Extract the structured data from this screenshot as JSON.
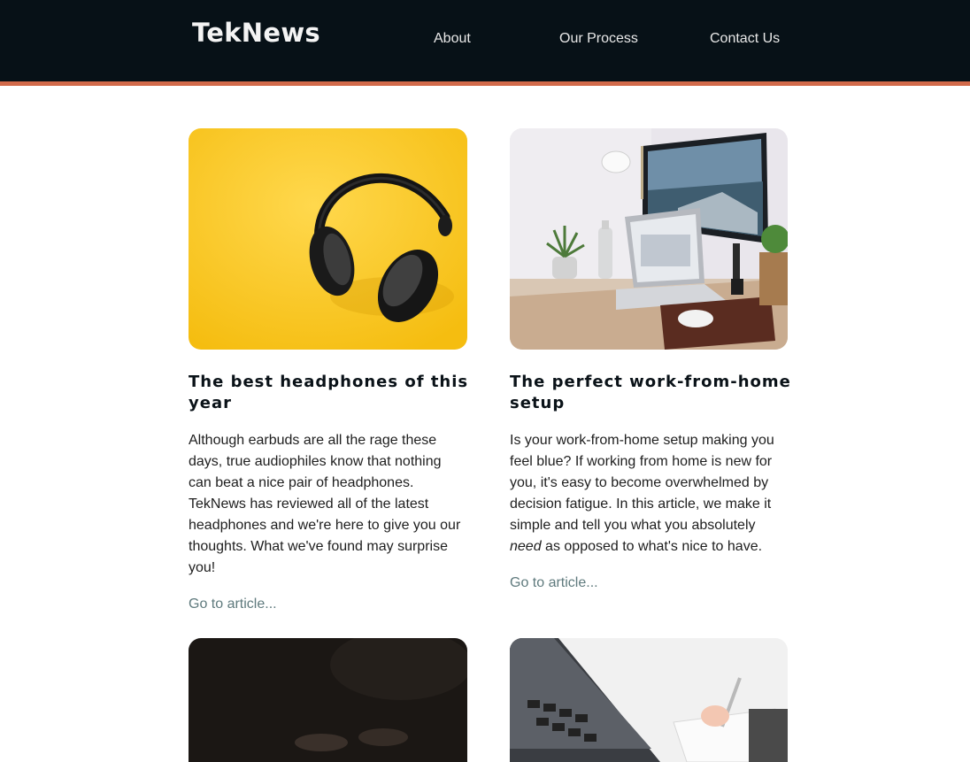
{
  "header": {
    "logo": "TekNews",
    "nav": [
      {
        "label": "About"
      },
      {
        "label": "Our Process"
      },
      {
        "label": "Contact Us"
      }
    ]
  },
  "colors": {
    "header_bg": "#071117",
    "accent_stripe": "#d26a4a",
    "link": "#5f7a7d"
  },
  "articles": [
    {
      "image": "headphones-on-yellow-photo",
      "title": "The best headphones of this year",
      "body": "Although earbuds are all the rage these days, true audiophiles know that nothing can beat a nice pair of headphones. TekNews has reviewed all of the latest headphones and we're here to give you our thoughts. What we've found may surprise you!",
      "link": "Go to article..."
    },
    {
      "image": "desk-workspace-photo",
      "title": "The perfect work-from-home setup",
      "body_before": "Is your work-from-home setup making you feel blue? If working from home is new for you, it's easy to become overwhelmed by decision fatigue. In this article, we make it simple and tell you what you absolutely",
      "body_emphasis": "need",
      "body_after": "as opposed to what's nice to have.",
      "link": "Go to article..."
    },
    {
      "image": "dark-hands-photo"
    },
    {
      "image": "laptop-and-notebook-photo"
    }
  ]
}
